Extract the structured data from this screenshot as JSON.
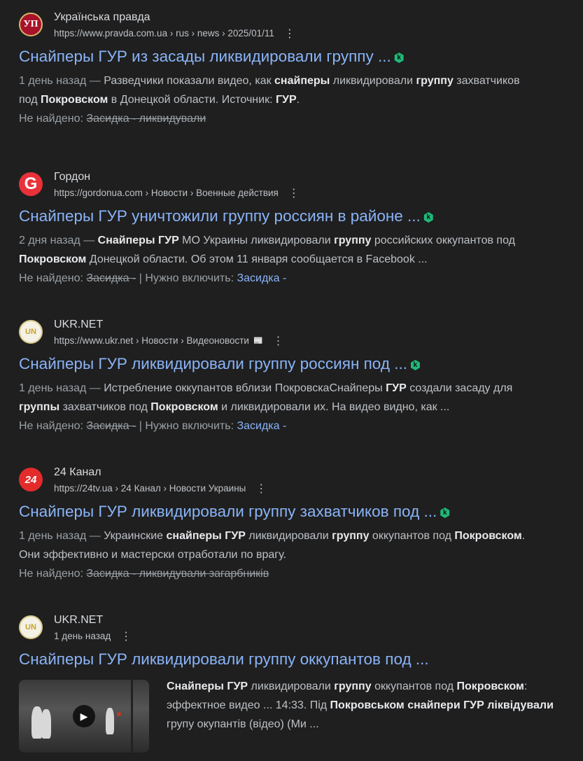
{
  "colors": {
    "background": "#1f1f1f",
    "link": "#8ab4f8",
    "text": "#bdc1c6",
    "kbadge": "#1fb978"
  },
  "results": [
    {
      "site_name": "Українська правда",
      "url": "https://www.pravda.com.ua › rus › news › 2025/01/11",
      "favicon_text": "УП",
      "title": "Снайперы ГУР из засады ликвидировали группу ...",
      "snippet_lines": [
        [
          {
            "t": "1 день назад — ",
            "c": "date"
          },
          {
            "t": "Разведчики показали видео, как "
          },
          {
            "t": "снайперы",
            "b": 1
          },
          {
            "t": " ликвидировали "
          },
          {
            "t": "группу",
            "b": 1
          },
          {
            "t": " захватчиков"
          }
        ],
        [
          {
            "t": "под "
          },
          {
            "t": "Покровском",
            "b": 1
          },
          {
            "t": " в Донецкой области. Источник: "
          },
          {
            "t": "ГУР",
            "b": 1
          },
          {
            "t": "."
          }
        ]
      ],
      "missing_label": "Не найдено:",
      "missing_terms": "Засидка - ликвидували",
      "include_label": "",
      "include_term": ""
    },
    {
      "site_name": "Гордон",
      "url": "https://gordonua.com › Новости › Военные действия",
      "favicon_text": "G",
      "title": "Снайперы ГУР уничтожили группу россиян в районе ...",
      "snippet_lines": [
        [
          {
            "t": "2 дня назад — ",
            "c": "date"
          },
          {
            "t": "Снайперы ГУР",
            "b": 1
          },
          {
            "t": " МО Украины ликвидировали "
          },
          {
            "t": "группу",
            "b": 1
          },
          {
            "t": " российских оккупантов под"
          }
        ],
        [
          {
            "t": "Покровском",
            "b": 1
          },
          {
            "t": " Донецкой области. Об этом 11 января сообщается в Facebook ..."
          }
        ]
      ],
      "missing_label": "Не найдено:",
      "missing_terms": "Засидка -",
      "include_label": "| Нужно включить:",
      "include_term": "Засидка -"
    },
    {
      "site_name": "UKR.NET",
      "url": "https://www.ukr.net › Новости › Видеоновости",
      "url_icon": "📰",
      "favicon_text": "UN",
      "title": "Снайперы ГУР ликвидировали группу россиян под ...",
      "snippet_lines": [
        [
          {
            "t": "1 день назад — ",
            "c": "date"
          },
          {
            "t": "Истребление оккупантов вблизи ПокровскаСнайперы "
          },
          {
            "t": "ГУР",
            "b": 1
          },
          {
            "t": " создали засаду для"
          }
        ],
        [
          {
            "t": "группы",
            "b": 1
          },
          {
            "t": " захватчиков под "
          },
          {
            "t": "Покровском",
            "b": 1
          },
          {
            "t": " и ликвидировали их. На видео видно, как ..."
          }
        ]
      ],
      "missing_label": "Не найдено:",
      "missing_terms": "Засидка -",
      "include_label": "| Нужно включить:",
      "include_term": "Засидка -"
    },
    {
      "site_name": "24 Канал",
      "url": "https://24tv.ua › 24 Канал › Новости Украины",
      "favicon_text": "24",
      "title": "Снайперы ГУР ликвидировали группу захватчиков под ...",
      "snippet_lines": [
        [
          {
            "t": "1 день назад — ",
            "c": "date"
          },
          {
            "t": "Украинские "
          },
          {
            "t": "снайперы ГУР",
            "b": 1
          },
          {
            "t": " ликвидировали "
          },
          {
            "t": "группу",
            "b": 1
          },
          {
            "t": " оккупантов под "
          },
          {
            "t": "Покровском",
            "b": 1
          },
          {
            "t": "."
          }
        ],
        [
          {
            "t": "Они эффективно и мастерски отработали по врагу."
          }
        ]
      ],
      "missing_label": "Не найдено:",
      "missing_terms": "Засидка - ликвидували загарбників",
      "include_label": "",
      "include_term": ""
    }
  ],
  "video_result": {
    "site_name": "UKR.NET",
    "date": "1 день назад",
    "favicon_text": "UN",
    "title": "Снайперы ГУР ликвидировали группу оккупантов под ...",
    "text_lines": [
      [
        {
          "t": "Снайперы ГУР",
          "b": 1
        },
        {
          "t": " ликвидировали "
        },
        {
          "t": "группу",
          "b": 1
        },
        {
          "t": " оккупантов под "
        },
        {
          "t": "Покровском",
          "b": 1
        },
        {
          "t": ":"
        }
      ],
      [
        {
          "t": "эффектное видео ... 14:33. Під "
        },
        {
          "t": "Покровськом снайпери ГУР ліквідували",
          "b": 1
        }
      ],
      [
        {
          "t": "групу окупантів (відео) (Ми ..."
        }
      ]
    ]
  }
}
